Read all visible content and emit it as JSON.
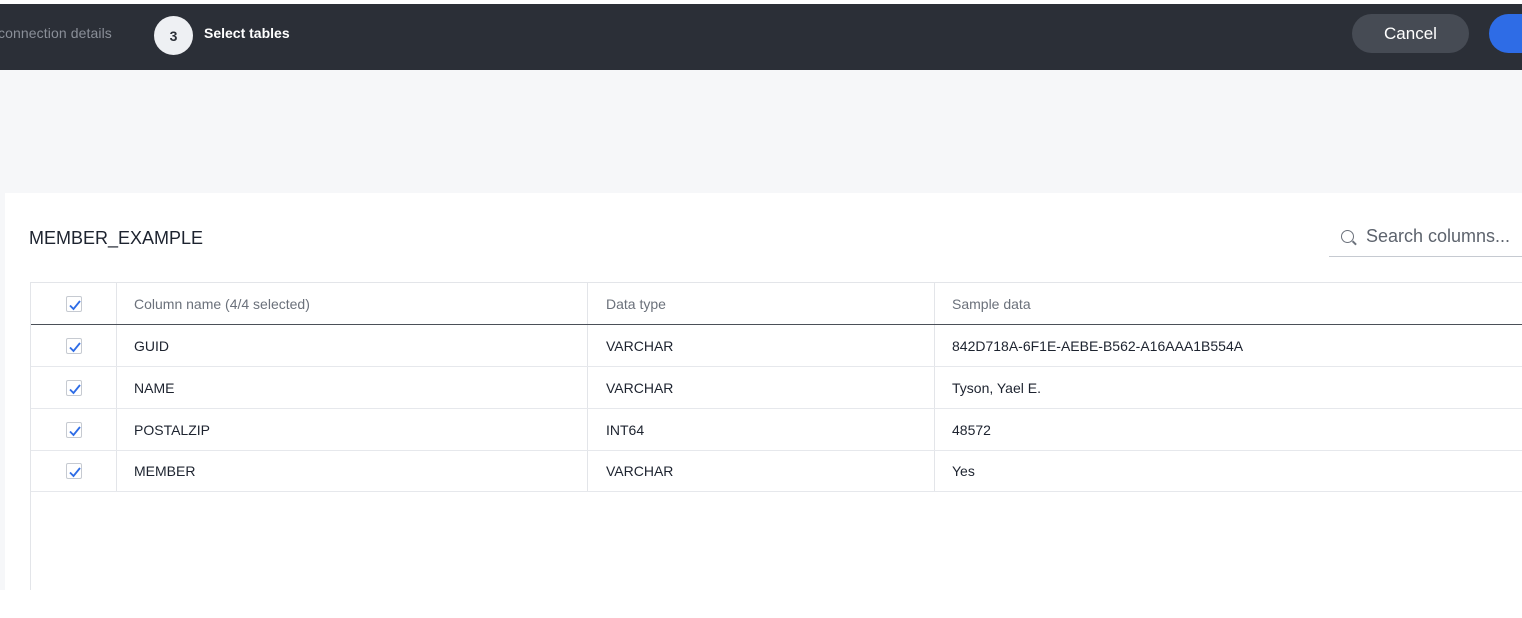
{
  "header": {
    "previous_step_label": "connection details",
    "current_step_number": "3",
    "current_step_label": "Select tables",
    "cancel_label": "Cancel"
  },
  "table_panel": {
    "title": "MEMBER_EXAMPLE",
    "search_placeholder": "Search columns..."
  },
  "grid": {
    "headers": {
      "column_name": "Column name (4/4 selected)",
      "data_type": "Data type",
      "sample_data": "Sample data"
    },
    "select_all_checked": true,
    "rows": [
      {
        "name": "GUID",
        "type": "VARCHAR",
        "sample": "842D718A-6F1E-AEBE-B562-A16AAA1B554A",
        "checked": true
      },
      {
        "name": "NAME",
        "type": "VARCHAR",
        "sample": "Tyson, Yael E.",
        "checked": true
      },
      {
        "name": "POSTALZIP",
        "type": "INT64",
        "sample": "48572",
        "checked": true
      },
      {
        "name": "MEMBER",
        "type": "VARCHAR",
        "sample": "Yes",
        "checked": true
      }
    ]
  },
  "colors": {
    "topbar": "#2b2f37",
    "primary": "#2e6ce6",
    "check": "#2e6ce6"
  }
}
